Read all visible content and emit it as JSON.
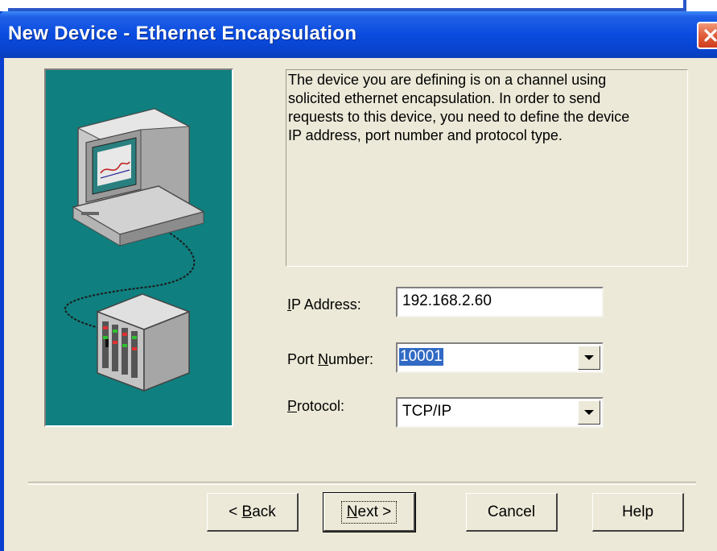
{
  "window": {
    "title": "New Device - Ethernet Encapsulation"
  },
  "description": {
    "lines": [
      "The device you are defining is on a channel using",
      "solicited ethernet encapsulation.  In order to send",
      "requests to this device, you need to define the device",
      "IP address, port number and protocol type."
    ]
  },
  "fields": {
    "ip_address": {
      "label_mnemonic": "I",
      "label_rest": "P Address:",
      "value": "192.168.2.60"
    },
    "port_number": {
      "label_pre": "Port ",
      "label_mnemonic": "N",
      "label_rest": "umber:",
      "value": "10001"
    },
    "protocol": {
      "label_mnemonic": "P",
      "label_rest": "rotocol:",
      "value": "TCP/IP"
    }
  },
  "buttons": {
    "back": {
      "pre": "< ",
      "mnemonic": "B",
      "rest": "ack"
    },
    "next": {
      "mnemonic": "N",
      "rest": "ext >"
    },
    "cancel": "Cancel",
    "help": "Help"
  },
  "colors": {
    "titlebar": "#0a4ce0",
    "image_panel_bg": "#0f7f7f",
    "dialog_bg": "#ece9d8",
    "selection": "#316ac5"
  },
  "icons": [
    "close-icon",
    "computer-monitor-icon",
    "network-device-icon",
    "dropdown-arrow-icon"
  ]
}
